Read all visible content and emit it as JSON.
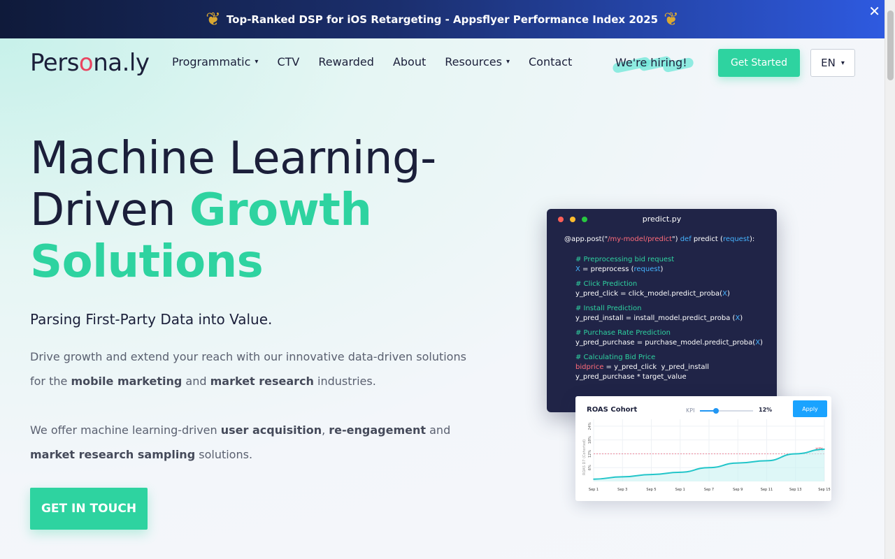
{
  "banner": {
    "text": "Top-Ranked DSP for iOS Retargeting - Appsflyer Performance Index 2025",
    "close_icon": "close-icon"
  },
  "header": {
    "logo_prefix": "Pers",
    "logo_o": "o",
    "logo_suffix": "na.ly",
    "nav": [
      {
        "label": "Programmatic",
        "has_dropdown": true
      },
      {
        "label": "CTV",
        "has_dropdown": false
      },
      {
        "label": "Rewarded",
        "has_dropdown": false
      },
      {
        "label": "About",
        "has_dropdown": false
      },
      {
        "label": "Resources",
        "has_dropdown": true
      },
      {
        "label": "Contact",
        "has_dropdown": false
      }
    ],
    "hiring": "We're hiring!",
    "get_started": "Get Started",
    "language": "EN"
  },
  "hero": {
    "title_line1": "Machine Learning-",
    "title_line2_plain": "Driven ",
    "title_line2_accent": "Growth",
    "title_line3_accent": "Solutions",
    "subtitle": "Parsing First-Party Data into Value.",
    "p1_a": "Drive growth and extend your reach with our innovative data-driven solutions for the ",
    "p1_b": "mobile marketing",
    "p1_c": " and ",
    "p1_d": "market research",
    "p1_e": " industries.",
    "p2_a": "We offer machine learning-driven ",
    "p2_b": "user acquisition",
    "p2_c": ", ",
    "p2_d": "re-engagement",
    "p2_e": " and ",
    "p2_f": "market research sampling",
    "p2_g": " solutions.",
    "cta": "GET IN TOUCH"
  },
  "code_card": {
    "filename": "predict.py",
    "l1_a": "@app.post(\"",
    "l1_b": "/my-model/predict",
    "l1_c": "\") ",
    "l1_d": "def",
    "l1_e": " predict (",
    "l1_f": "request",
    "l1_g": "):",
    "c1": "# Preprocessing bid request",
    "l2_a": "X",
    "l2_b": " = preprocess (",
    "l2_c": "request",
    "l2_d": ")",
    "c2": "# Click Prediction",
    "l3_a": "y_pred_click = click_model.predict_proba(",
    "l3_b": "X",
    "l3_c": ")",
    "c3": "# Install Prediction",
    "l4_a": "y_pred_install = install_model.predict_proba (",
    "l4_b": "X",
    "l4_c": ")",
    "c4": "# Purchase Rate Prediction",
    "l5_a": "y_pred_purchase = purchase_model.predict_proba(",
    "l5_b": "X",
    "l5_c": ")",
    "c5": "# Calculating Bid Price",
    "l6_a": "bidprice",
    "l6_b": " = y_pred_click  y_pred_install",
    "l7": "y_pred_purchase * target_value",
    "dot_colors": [
      "#ff5f57",
      "#febc2e",
      "#28c840"
    ]
  },
  "roas_card": {
    "title": "ROAS Cohort",
    "kpi_label": "KPI",
    "kpi_value": "12%",
    "kpi_fraction": 0.3,
    "apply": "Apply",
    "kpi_line_label": "KPI"
  },
  "chart_data": {
    "type": "area",
    "title": "ROAS Cohort",
    "ylabel": "ROAS D7 (Cohorted)",
    "yticks": [
      "6%",
      "12%",
      "18%",
      "24%"
    ],
    "ylim": [
      0,
      27
    ],
    "categories": [
      "Sep 1",
      "Sep 3",
      "Sep 5",
      "Sep 1",
      "Sep 7",
      "Sep 9",
      "Sep 11",
      "Sep 13",
      "Sep 15"
    ],
    "values": [
      1,
      2,
      3,
      4,
      6,
      8,
      9,
      12,
      14
    ],
    "kpi_line": 12,
    "colors": {
      "line": "#22c5c9",
      "fill": "#c8f2f1",
      "kpi": "#e94560"
    }
  },
  "colors": {
    "accent": "#2ed3a0",
    "brand_dark": "#1b1f3a",
    "logo_red": "#e94560"
  }
}
